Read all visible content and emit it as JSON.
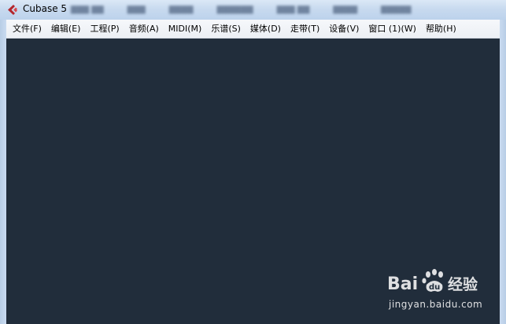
{
  "window": {
    "title": "Cubase 5"
  },
  "menu": [
    "文件(F)",
    "编辑(E)",
    "工程(P)",
    "音频(A)",
    "MIDI(M)",
    "乐谱(S)",
    "媒体(D)",
    "走带(T)",
    "设备(V)",
    "窗口 (1)(W)",
    "帮助(H)"
  ],
  "watermark": {
    "logo_text": "Bai du 经验",
    "url": "jingyan.baidu.com"
  },
  "colors": {
    "workspace": "#212d3b",
    "menubar": "#eceff4",
    "titlebar": "#c8daef",
    "app_icon": "#b3262c"
  }
}
